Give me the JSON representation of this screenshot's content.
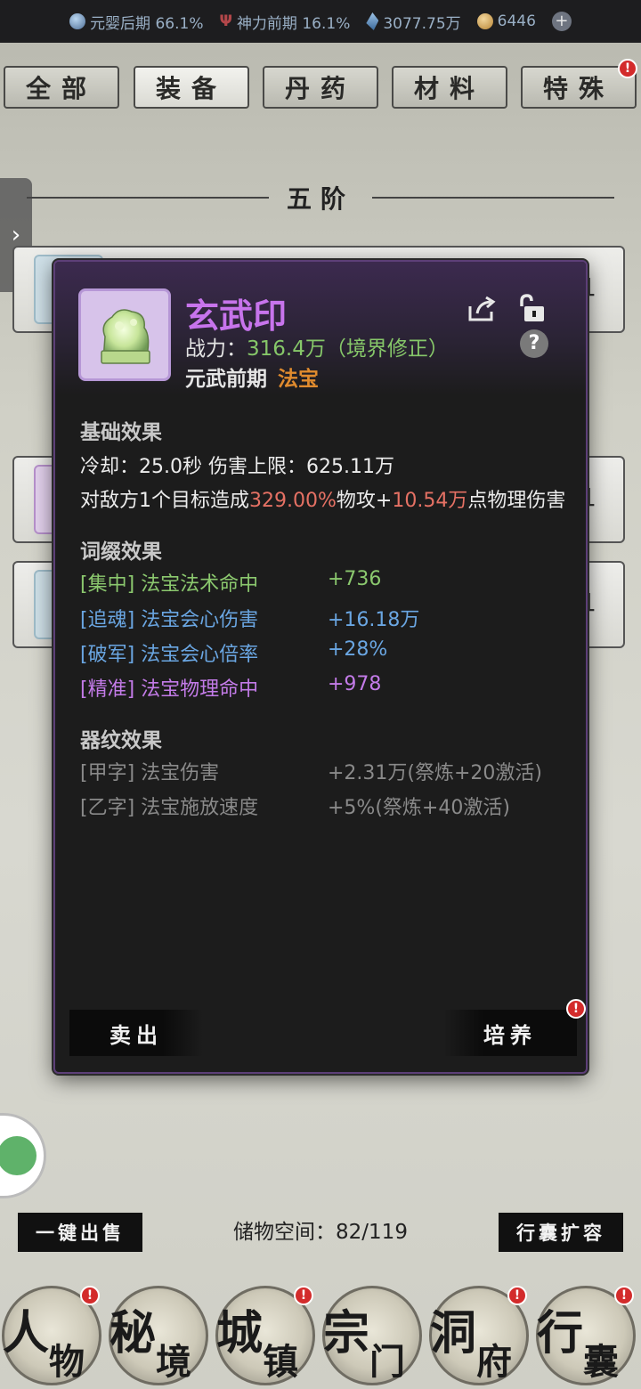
{
  "status": {
    "realm_main": "元婴后期 66.1%",
    "divine_power": "神力前期 16.1%",
    "spirit_stone": "3077.75万",
    "coins": "6446"
  },
  "tabs": [
    {
      "label": "全部"
    },
    {
      "label": "装备"
    },
    {
      "label": "丹药"
    },
    {
      "label": "材料"
    },
    {
      "label": "特殊"
    }
  ],
  "badge": "!",
  "tier": {
    "title": "五阶"
  },
  "background_rows": [
    {
      "count": "1"
    },
    {
      "count": "1"
    },
    {
      "count": "x1"
    }
  ],
  "popup": {
    "name": "玄武印",
    "power_label": "战力：",
    "power_value": "316.4万（境界修正）",
    "realm": "元武前期",
    "type": "法宝",
    "help": "?",
    "basic_title": "基础效果",
    "basic_line1": "冷却：25.0秒 伤害上限：625.11万",
    "basic_line2_a": "对敌方1个目标造成",
    "basic_line2_b": "329.00%",
    "basic_line2_c": "物攻+",
    "basic_line2_d": "10.54万",
    "basic_line2_e": "点物理伤害",
    "affix_title": "词缀效果",
    "affixes": [
      {
        "name": "[集中] 法宝法术命中",
        "value": "+736",
        "color": "#8bc86e"
      },
      {
        "name": "[追魂] 法宝会心伤害",
        "value": "+16.18万",
        "color": "#6aa6e2"
      },
      {
        "name": "[破军] 法宝会心倍率",
        "value": "+28%",
        "color": "#6aa6e2"
      },
      {
        "name": "[精准] 法宝物理命中",
        "value": "+978",
        "color": "#c37be8"
      }
    ],
    "pattern_title": "器纹效果",
    "patterns": [
      {
        "name": "[甲字] 法宝伤害",
        "value": "+2.31万(祭炼+20激活)"
      },
      {
        "name": "[乙字] 法宝施放速度",
        "value": "+5%(祭炼+40激活)"
      }
    ],
    "sell_label": "卖出",
    "train_label": "培养"
  },
  "bottom": {
    "quick_sell": "一键出售",
    "storage": "储物空间：82/119",
    "expand": "行囊扩容"
  },
  "nav": [
    {
      "c1": "人",
      "c2": "物"
    },
    {
      "c1": "秘",
      "c2": "境"
    },
    {
      "c1": "城",
      "c2": "镇"
    },
    {
      "c1": "宗",
      "c2": "门"
    },
    {
      "c1": "洞",
      "c2": "府"
    },
    {
      "c1": "行",
      "c2": "囊"
    }
  ]
}
